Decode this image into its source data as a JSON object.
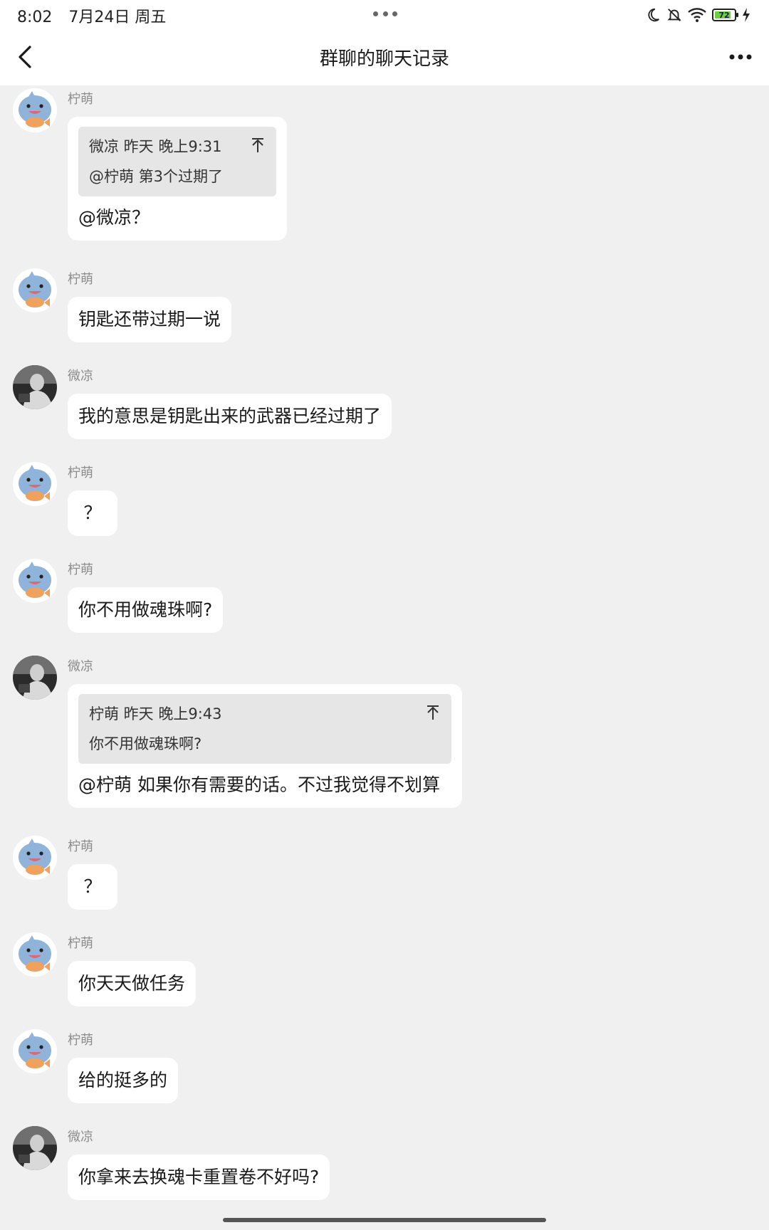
{
  "status_bar": {
    "time": "8:02",
    "date": "7月24日 周五",
    "battery": "72",
    "battery_level": 0.72
  },
  "header": {
    "title": "群聊的聊天记录"
  },
  "messages": [
    {
      "sender": "柠萌",
      "avatar": "shark-avatar",
      "quote": {
        "meta": "微凉 昨天 晚上9:31",
        "text": "@柠萌 第3个过期了"
      },
      "text": "@微凉？"
    },
    {
      "sender": "柠萌",
      "avatar": "shark-avatar",
      "text": "钥匙还带过期一说"
    },
    {
      "sender": "微凉",
      "avatar": "photo-avatar",
      "text": "我的意思是钥匙出来的武器已经过期了"
    },
    {
      "sender": "柠萌",
      "avatar": "shark-avatar",
      "text": "？"
    },
    {
      "sender": "柠萌",
      "avatar": "shark-avatar",
      "text": "你不用做魂珠啊?"
    },
    {
      "sender": "微凉",
      "avatar": "photo-avatar",
      "quote": {
        "meta": "柠萌 昨天 晚上9:43",
        "text": "你不用做魂珠啊?"
      },
      "text": "@柠萌 如果你有需要的话。不过我觉得不划算"
    },
    {
      "sender": "柠萌",
      "avatar": "shark-avatar",
      "text": "？"
    },
    {
      "sender": "柠萌",
      "avatar": "shark-avatar",
      "text": "你天天做任务"
    },
    {
      "sender": "柠萌",
      "avatar": "shark-avatar",
      "text": "给的挺多的"
    },
    {
      "sender": "微凉",
      "avatar": "photo-avatar",
      "text": "你拿来去换魂卡重置卷不好吗?"
    }
  ]
}
